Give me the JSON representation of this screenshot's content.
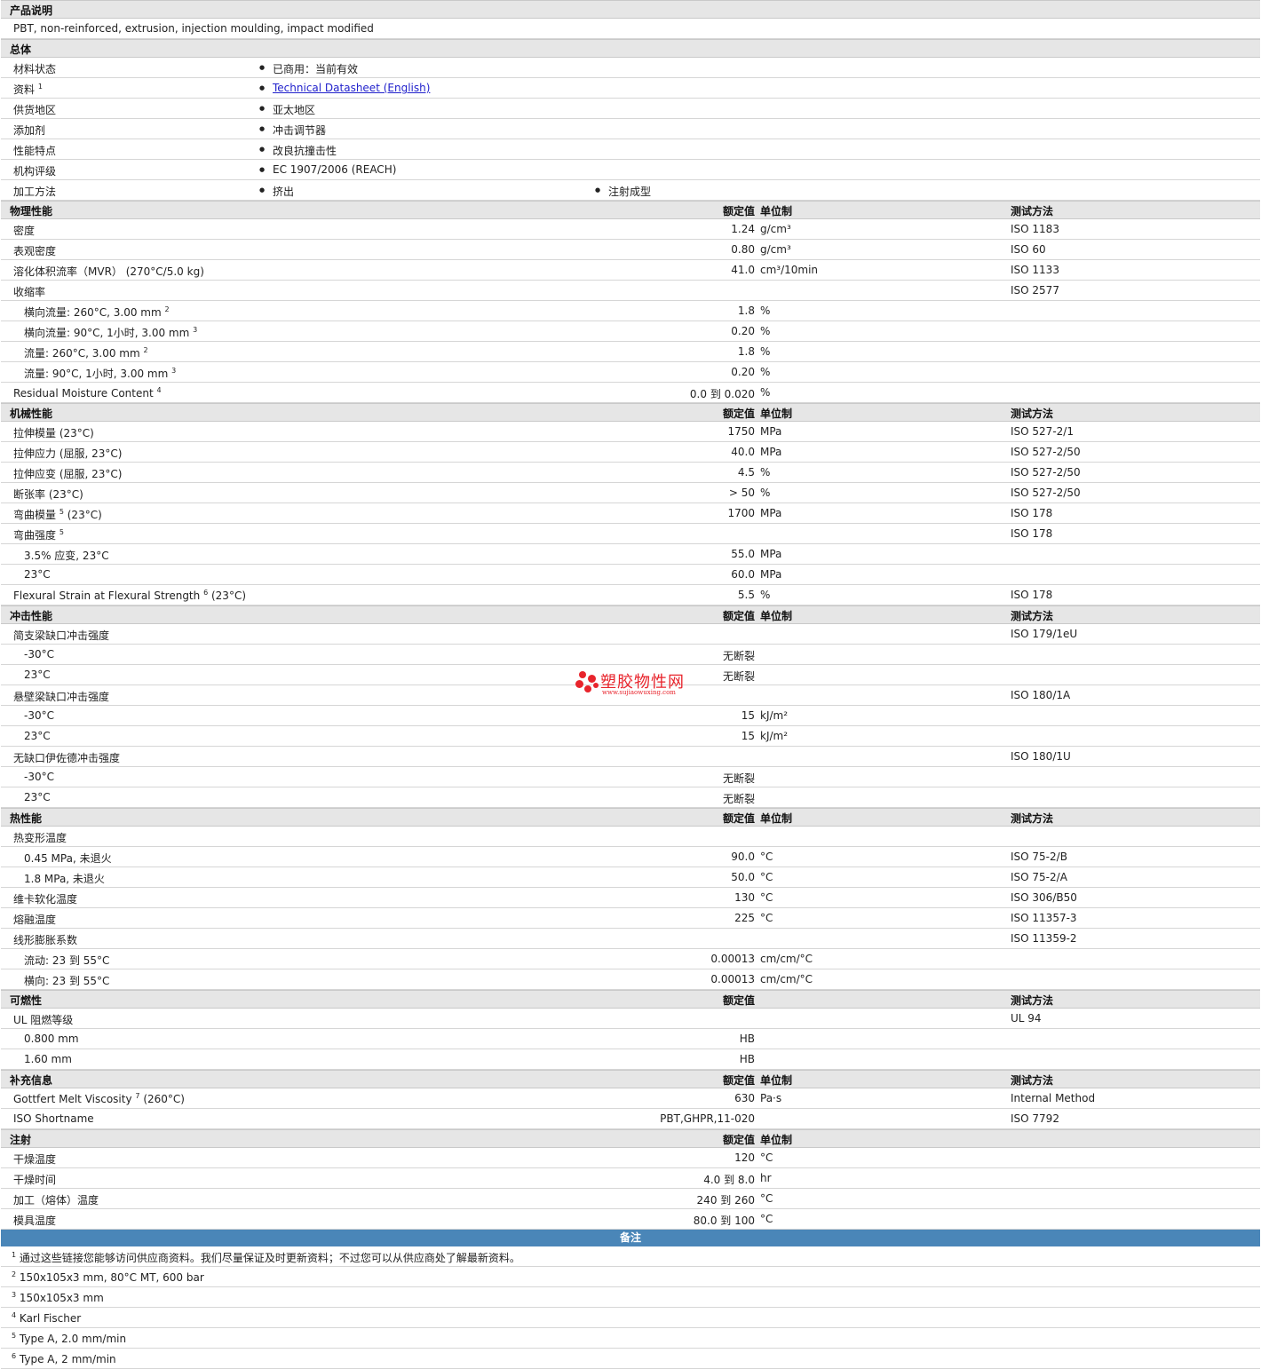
{
  "product_desc": {
    "header": "产品说明",
    "text": "PBT, non-reinforced, extrusion, injection moulding, impact modified"
  },
  "general": {
    "header": "总体",
    "rows": [
      {
        "label": "材料状态",
        "items": [
          "已商用：当前有效"
        ]
      },
      {
        "label": "资料",
        "sup": "1",
        "link": "Technical Datasheet (English)"
      },
      {
        "label": "供货地区",
        "items": [
          "亚太地区"
        ]
      },
      {
        "label": "添加剂",
        "items": [
          "冲击调节器"
        ]
      },
      {
        "label": "性能特点",
        "items": [
          "改良抗撞击性"
        ]
      },
      {
        "label": "机构评级",
        "items": [
          "EC 1907/2006 (REACH)"
        ]
      },
      {
        "label": "加工方法",
        "items": [
          "挤出",
          "注射成型"
        ]
      }
    ]
  },
  "col_headers": {
    "value": "额定值",
    "unit": "单位制",
    "method": "测试方法"
  },
  "sections": [
    {
      "title": "物理性能",
      "has_unit": true,
      "rows": [
        {
          "label": "密度",
          "value": "1.24",
          "unit": "g/cm³",
          "method": "ISO 1183"
        },
        {
          "label": "表观密度",
          "value": "0.80",
          "unit": "g/cm³",
          "method": "ISO 60"
        },
        {
          "label": "溶化体积流率（MVR） (270°C/5.0 kg)",
          "value": "41.0",
          "unit": "cm³/10min",
          "method": "ISO 1133"
        },
        {
          "label": "收缩率",
          "value": "",
          "unit": "",
          "method": "ISO 2577"
        },
        {
          "label": "横向流量: 260°C, 3.00 mm",
          "sup": "2",
          "sub": true,
          "value": "1.8",
          "unit": "%",
          "method": ""
        },
        {
          "label": "横向流量: 90°C, 1小时, 3.00 mm",
          "sup": "3",
          "sub": true,
          "value": "0.20",
          "unit": "%",
          "method": ""
        },
        {
          "label": "流量: 260°C, 3.00 mm",
          "sup": "2",
          "sub": true,
          "value": "1.8",
          "unit": "%",
          "method": ""
        },
        {
          "label": "流量: 90°C, 1小时, 3.00 mm",
          "sup": "3",
          "sub": true,
          "value": "0.20",
          "unit": "%",
          "method": ""
        },
        {
          "label": "Residual Moisture Content",
          "sup": "4",
          "value": "0.0 到  0.020",
          "unit": "%",
          "method": ""
        }
      ]
    },
    {
      "title": "机械性能",
      "has_unit": true,
      "rows": [
        {
          "label": "拉伸模量 (23°C)",
          "value": "1750",
          "unit": "MPa",
          "method": "ISO 527-2/1"
        },
        {
          "label": "拉伸应力 (屈服, 23°C)",
          "value": "40.0",
          "unit": "MPa",
          "method": "ISO 527-2/50"
        },
        {
          "label": "拉伸应变 (屈服, 23°C)",
          "value": "4.5",
          "unit": "%",
          "method": "ISO 527-2/50"
        },
        {
          "label": "断张率 (23°C)",
          "value": "> 50",
          "unit": "%",
          "method": "ISO 527-2/50"
        },
        {
          "label": "弯曲模量",
          "sup": "5",
          "after": " (23°C)",
          "value": "1700",
          "unit": "MPa",
          "method": "ISO 178"
        },
        {
          "label": "弯曲强度",
          "sup": "5",
          "value": "",
          "unit": "",
          "method": "ISO 178"
        },
        {
          "label": "3.5% 应变, 23°C",
          "sub": true,
          "value": "55.0",
          "unit": "MPa",
          "method": ""
        },
        {
          "label": "23°C",
          "sub": true,
          "value": "60.0",
          "unit": "MPa",
          "method": ""
        },
        {
          "label": "Flexural Strain at Flexural Strength",
          "sup": "6",
          "after": " (23°C)",
          "value": "5.5",
          "unit": "%",
          "method": "ISO 178"
        }
      ]
    },
    {
      "title": "冲击性能",
      "has_unit": true,
      "rows": [
        {
          "label": "简支梁缺口冲击强度",
          "value": "",
          "unit": "",
          "method": "ISO 179/1eU"
        },
        {
          "label": "-30°C",
          "sub": true,
          "value": "无断裂",
          "unit": "",
          "method": ""
        },
        {
          "label": "23°C",
          "sub": true,
          "value": "无断裂",
          "unit": "",
          "method": ""
        },
        {
          "label": "悬壁梁缺口冲击强度",
          "value": "",
          "unit": "",
          "method": "ISO 180/1A"
        },
        {
          "label": "-30°C",
          "sub": true,
          "value": "15",
          "unit": "kJ/m²",
          "method": ""
        },
        {
          "label": "23°C",
          "sub": true,
          "value": "15",
          "unit": "kJ/m²",
          "method": ""
        },
        {
          "label": "无缺口伊佐德冲击强度",
          "value": "",
          "unit": "",
          "method": "ISO 180/1U"
        },
        {
          "label": "-30°C",
          "sub": true,
          "value": "无断裂",
          "unit": "",
          "method": ""
        },
        {
          "label": "23°C",
          "sub": true,
          "value": "无断裂",
          "unit": "",
          "method": ""
        }
      ]
    },
    {
      "title": "热性能",
      "has_unit": true,
      "rows": [
        {
          "label": "热变形温度",
          "value": "",
          "unit": "",
          "method": ""
        },
        {
          "label": "0.45 MPa, 未退火",
          "sub": true,
          "value": "90.0",
          "unit": "°C",
          "method": "ISO 75-2/B"
        },
        {
          "label": "1.8 MPa, 未退火",
          "sub": true,
          "value": "50.0",
          "unit": "°C",
          "method": "ISO 75-2/A"
        },
        {
          "label": "维卡软化温度",
          "value": "130",
          "unit": "°C",
          "method": "ISO 306/B50"
        },
        {
          "label": "熔融温度",
          "value": "225",
          "unit": "°C",
          "method": "ISO 11357-3"
        },
        {
          "label": "线形膨胀系数",
          "value": "",
          "unit": "",
          "method": "ISO 11359-2"
        },
        {
          "label": "流动: 23 到  55°C",
          "sub": true,
          "value": "0.00013",
          "unit": "cm/cm/°C",
          "method": ""
        },
        {
          "label": "横向: 23 到  55°C",
          "sub": true,
          "value": "0.00013",
          "unit": "cm/cm/°C",
          "method": ""
        }
      ]
    },
    {
      "title": "可燃性",
      "has_unit": false,
      "rows": [
        {
          "label": "UL 阻燃等级",
          "value": "",
          "unit": "",
          "method": "UL 94"
        },
        {
          "label": "0.800 mm",
          "sub": true,
          "value": "HB",
          "unit": "",
          "method": ""
        },
        {
          "label": "1.60 mm",
          "sub": true,
          "value": "HB",
          "unit": "",
          "method": ""
        }
      ]
    },
    {
      "title": "补充信息",
      "has_unit": true,
      "rows": [
        {
          "label": "Gottfert Melt Viscosity",
          "sup": "7",
          "after": " (260°C)",
          "value": "630",
          "unit": "Pa·s",
          "method": "Internal Method"
        },
        {
          "label": "ISO Shortname",
          "value": "PBT,GHPR,11-020",
          "unit": "",
          "method": "ISO 7792"
        }
      ]
    },
    {
      "title": "注射",
      "has_unit": true,
      "no_method": true,
      "rows": [
        {
          "label": "干燥温度",
          "value": "120",
          "unit": "°C",
          "method": ""
        },
        {
          "label": "干燥时间",
          "value": "4.0 到  8.0",
          "unit": "hr",
          "method": ""
        },
        {
          "label": "加工（熔体）温度",
          "value": "240 到  260",
          "unit": "°C",
          "method": ""
        },
        {
          "label": "模具温度",
          "value": "80.0 到  100",
          "unit": "°C",
          "method": ""
        }
      ]
    }
  ],
  "notes": {
    "header": "备注",
    "items": [
      {
        "n": "1",
        "text": "通过这些链接您能够访问供应商资料。我们尽量保证及时更新资料；不过您可以从供应商处了解最新资料。"
      },
      {
        "n": "2",
        "text": "150x105x3 mm, 80°C MT, 600 bar"
      },
      {
        "n": "3",
        "text": "150x105x3 mm"
      },
      {
        "n": "4",
        "text": "Karl Fischer"
      },
      {
        "n": "5",
        "text": "Type A, 2.0 mm/min"
      },
      {
        "n": "6",
        "text": "Type A, 2 mm/min"
      }
    ]
  },
  "watermark": {
    "title": "塑胶物性网",
    "url": "www.sujiaowuxing.com",
    "color": "#e8242c"
  }
}
